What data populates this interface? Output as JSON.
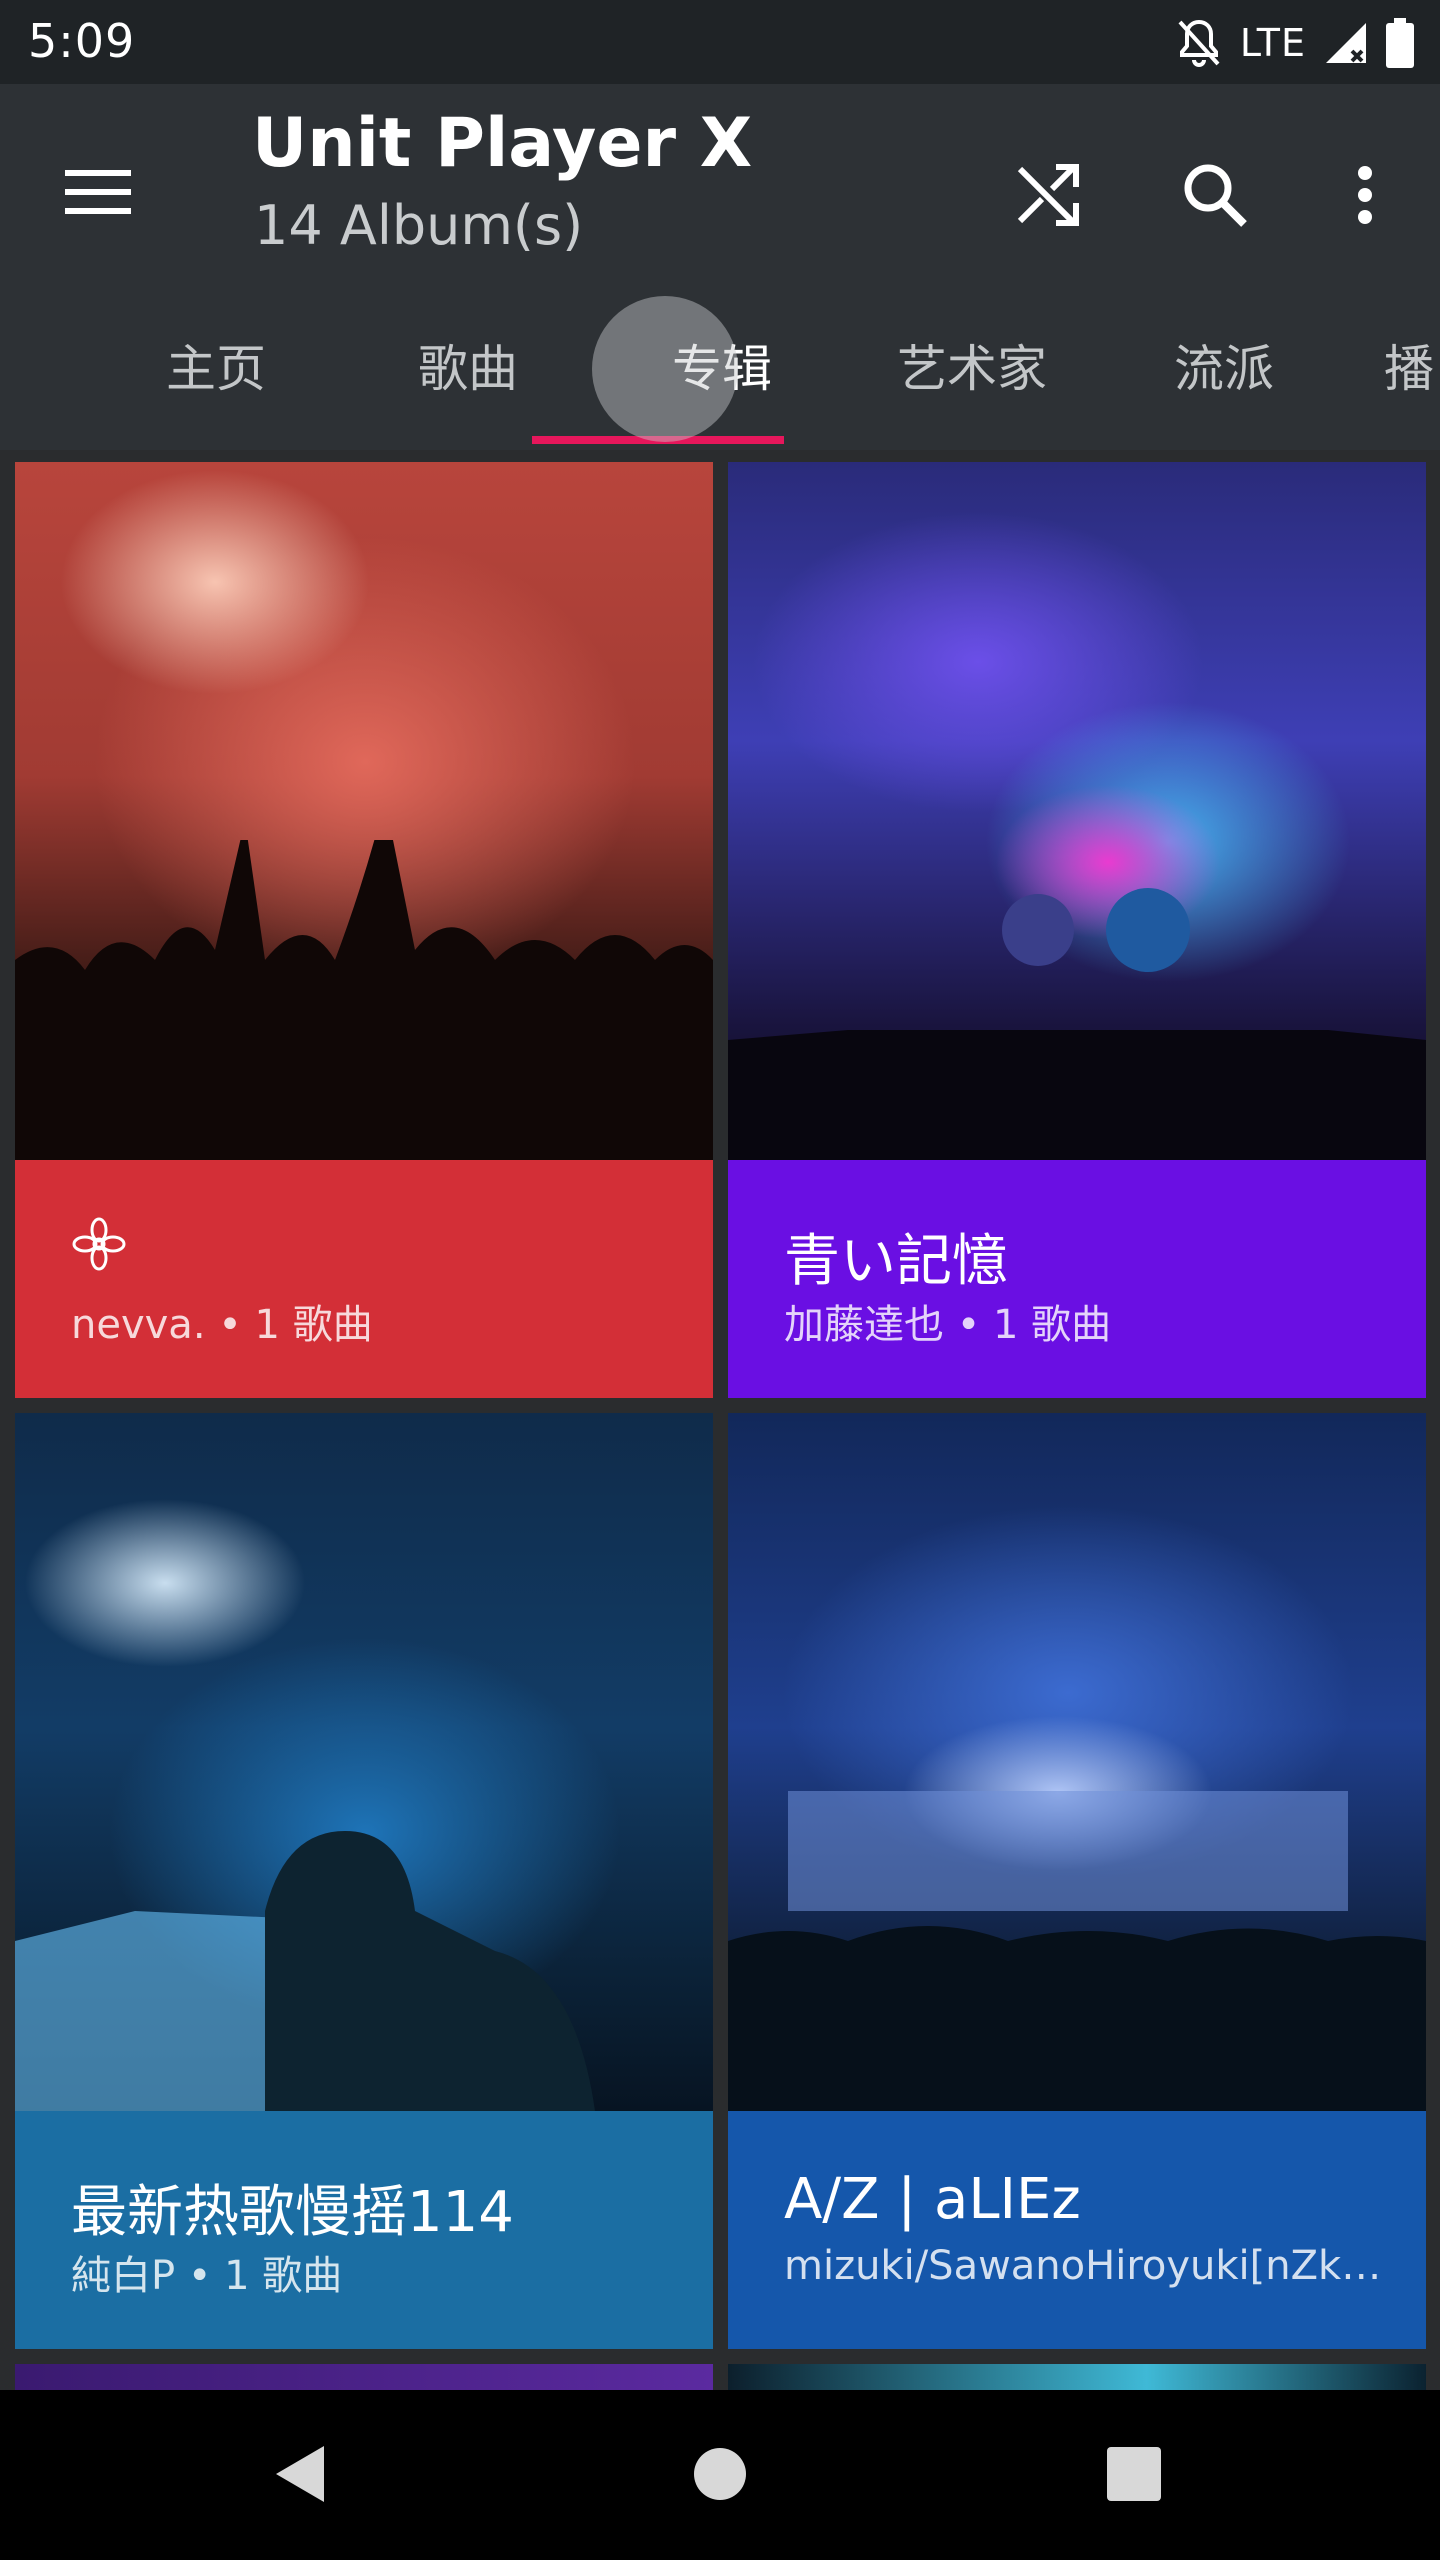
{
  "status_bar": {
    "time": "5:09",
    "network": "LTE"
  },
  "app_bar": {
    "title": "Unit Player X",
    "subtitle": "14 Album(s)",
    "icons": {
      "menu": "menu-icon",
      "shuffle": "shuffle-icon",
      "search": "search-icon",
      "more": "more-vert-icon"
    }
  },
  "tabs": [
    {
      "label": "主页"
    },
    {
      "label": "歌曲"
    },
    {
      "label": "专辑",
      "active": true
    },
    {
      "label": "艺术家"
    },
    {
      "label": "流派"
    },
    {
      "label": "播"
    }
  ],
  "albums": [
    {
      "name": "",
      "artist": "nevva.",
      "songs": "1 歌曲",
      "meta": "nevva. • 1 歌曲",
      "color": "#d32f37"
    },
    {
      "name": "青い記憶",
      "artist": "加藤達也",
      "songs": "1 歌曲",
      "meta": "加藤達也 • 1 歌曲",
      "color": "#6a0fe3"
    },
    {
      "name": "最新热歌慢摇114",
      "artist": "純白P",
      "songs": "1 歌曲",
      "meta": "純白P • 1 歌曲",
      "color": "#1b6ea3"
    },
    {
      "name": "A/Z | aLIEz",
      "artist": "mizuki/SawanoHiroyuki[nZk]...",
      "meta": "mizuki/SawanoHiroyuki[nZk]...",
      "color": "#1557ab"
    }
  ],
  "colors": {
    "accent": "#e6175c",
    "app_bar": "#2d3135",
    "status_bar": "#1f2326"
  },
  "nav_bar": {
    "icons": [
      "back-icon",
      "home-icon",
      "recents-icon"
    ]
  }
}
